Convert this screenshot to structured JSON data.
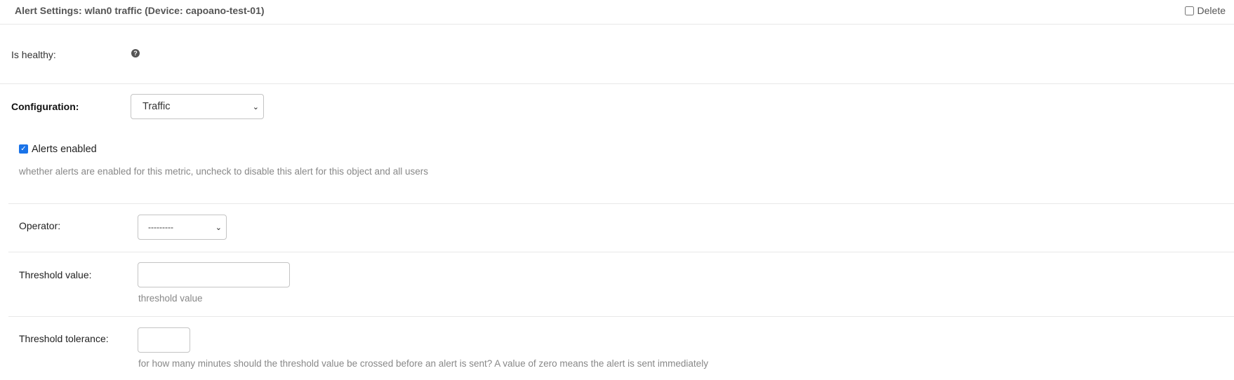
{
  "header": {
    "title": "Alert Settings: wlan0 traffic (Device: capoano-test-01)",
    "delete_label": "Delete"
  },
  "health": {
    "label": "Is healthy:",
    "help_icon": "question-circle-icon"
  },
  "configuration": {
    "label": "Configuration:",
    "selected": "Traffic"
  },
  "alerts": {
    "enabled_label": "Alerts enabled",
    "enabled": true,
    "help": "whether alerts are enabled for this metric, uncheck to disable this alert for this object and all users"
  },
  "operator": {
    "label": "Operator:",
    "selected": "---------"
  },
  "threshold": {
    "label": "Threshold value:",
    "value": "",
    "help": "threshold value"
  },
  "tolerance": {
    "label": "Threshold tolerance:",
    "value": "",
    "help": "for how many minutes should the threshold value be crossed before an alert is sent? A value of zero means the alert is sent immediately"
  },
  "colors": {
    "checkbox_accent": "#1a73e8",
    "help_text": "#888888",
    "border": "#c4c4c4"
  }
}
